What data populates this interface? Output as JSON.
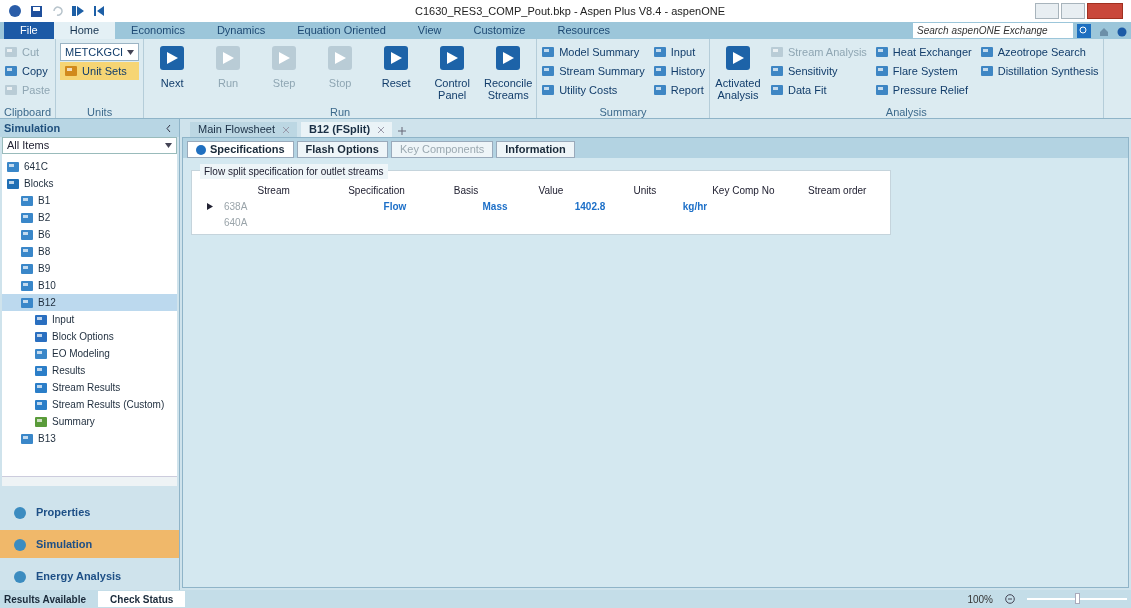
{
  "window": {
    "title": "C1630_RES3_COMP_Pout.bkp - Aspen Plus V8.4 - aspenONE"
  },
  "ribbon": {
    "tabs": [
      {
        "label": "File",
        "kind": "file",
        "selected": false
      },
      {
        "label": "Home",
        "kind": "tab",
        "selected": true
      },
      {
        "label": "Economics",
        "kind": "tab",
        "selected": false
      },
      {
        "label": "Dynamics",
        "kind": "tab",
        "selected": false
      },
      {
        "label": "Equation Oriented",
        "kind": "tab",
        "selected": false
      },
      {
        "label": "View",
        "kind": "tab",
        "selected": false
      },
      {
        "label": "Customize",
        "kind": "tab",
        "selected": false
      },
      {
        "label": "Resources",
        "kind": "tab",
        "selected": false
      }
    ],
    "search": {
      "placeholder": "Search aspenONE Exchange"
    },
    "groups": [
      {
        "label": "Clipboard",
        "columns": [
          [
            {
              "label": "Cut",
              "kind": "small",
              "disabled": true
            },
            {
              "label": "Copy",
              "kind": "small",
              "disabled": false
            },
            {
              "label": "Paste",
              "kind": "small",
              "disabled": true
            }
          ]
        ]
      },
      {
        "label": "Units",
        "columns": [
          [
            {
              "label": "METCKGCI",
              "kind": "dropdown",
              "disabled": false
            },
            {
              "label": "Unit Sets",
              "kind": "highlight",
              "disabled": false
            }
          ]
        ]
      },
      {
        "label": "Run",
        "columns": [
          [
            {
              "label": "Next",
              "kind": "large",
              "disabled": false
            }
          ],
          [
            {
              "label": "Run",
              "kind": "large",
              "disabled": true
            }
          ],
          [
            {
              "label": "Step",
              "kind": "large",
              "disabled": true
            }
          ],
          [
            {
              "label": "Stop",
              "kind": "large",
              "disabled": true
            }
          ],
          [
            {
              "label": "Reset",
              "kind": "large",
              "disabled": false
            }
          ],
          [
            {
              "label": "Control Panel",
              "kind": "large",
              "disabled": false
            }
          ],
          [
            {
              "label": "Reconcile Streams",
              "kind": "large",
              "disabled": false
            }
          ]
        ]
      },
      {
        "label": "Summary",
        "columns": [
          [
            {
              "label": "Model Summary",
              "kind": "small",
              "disabled": false
            },
            {
              "label": "Stream Summary",
              "kind": "small",
              "disabled": false
            },
            {
              "label": "Utility Costs",
              "kind": "small",
              "disabled": false
            }
          ],
          [
            {
              "label": "Input",
              "kind": "small",
              "disabled": false
            },
            {
              "label": "History",
              "kind": "small",
              "disabled": false
            },
            {
              "label": "Report",
              "kind": "small",
              "disabled": false
            }
          ]
        ]
      },
      {
        "label": "Analysis",
        "columns": [
          [
            {
              "label": "Activated Analysis",
              "kind": "large",
              "disabled": false
            }
          ],
          [
            {
              "label": "Stream Analysis",
              "kind": "small",
              "disabled": true
            },
            {
              "label": "Sensitivity",
              "kind": "small",
              "disabled": false
            },
            {
              "label": "Data Fit",
              "kind": "small",
              "disabled": false
            }
          ],
          [
            {
              "label": "Heat Exchanger",
              "kind": "small",
              "disabled": false
            },
            {
              "label": "Flare System",
              "kind": "small",
              "disabled": false
            },
            {
              "label": "Pressure Relief",
              "kind": "small",
              "disabled": false
            }
          ],
          [
            {
              "label": "Azeotrope Search",
              "kind": "small",
              "disabled": false
            },
            {
              "label": "Distillation Synthesis",
              "kind": "small",
              "disabled": false
            }
          ]
        ]
      }
    ]
  },
  "navigator": {
    "title": "Simulation",
    "filter": "All Items",
    "tree": [
      {
        "label": "641C",
        "kind": "folder",
        "selected": false
      },
      {
        "label": "Blocks",
        "kind": "root",
        "selected": false,
        "children": [
          {
            "label": "B1",
            "kind": "folder",
            "selected": false
          },
          {
            "label": "B2",
            "kind": "folder",
            "selected": false
          },
          {
            "label": "B6",
            "kind": "folder",
            "selected": false
          },
          {
            "label": "B8",
            "kind": "folder",
            "selected": false
          },
          {
            "label": "B9",
            "kind": "folder",
            "selected": false
          },
          {
            "label": "B10",
            "kind": "folder",
            "selected": false
          },
          {
            "label": "B12",
            "kind": "folder",
            "selected": true,
            "children": [
              {
                "label": "Input",
                "kind": "form",
                "selected": false
              },
              {
                "label": "Block Options",
                "kind": "form",
                "selected": false
              },
              {
                "label": "EO Modeling",
                "kind": "folder",
                "selected": false
              },
              {
                "label": "Results",
                "kind": "result",
                "selected": false
              },
              {
                "label": "Stream Results",
                "kind": "result",
                "selected": false
              },
              {
                "label": "Stream Results (Custom)",
                "kind": "result",
                "selected": false
              },
              {
                "label": "Summary",
                "kind": "summary",
                "selected": false
              }
            ]
          },
          {
            "label": "B13",
            "kind": "folder",
            "selected": false
          }
        ]
      }
    ],
    "panes": [
      {
        "label": "Properties",
        "selected": false
      },
      {
        "label": "Simulation",
        "selected": true
      },
      {
        "label": "Energy Analysis",
        "selected": false
      }
    ]
  },
  "documents": [
    {
      "label": "Main Flowsheet",
      "selected": false
    },
    {
      "label": "B12 (FSplit)",
      "selected": true
    }
  ],
  "form": {
    "tabs": [
      {
        "label": "Specifications",
        "selected": true,
        "disabled": false
      },
      {
        "label": "Flash Options",
        "selected": false,
        "disabled": false
      },
      {
        "label": "Key Components",
        "selected": false,
        "disabled": true
      },
      {
        "label": "Information",
        "selected": false,
        "disabled": false
      }
    ],
    "section": "Flow split specification for outlet streams",
    "columns": [
      "Stream",
      "Specification",
      "Basis",
      "Value",
      "Units",
      "Key Comp No",
      "Stream order"
    ],
    "rows": [
      {
        "current": true,
        "cells": [
          "638A",
          "Flow",
          "Mass",
          "1402.8",
          "kg/hr"
        ]
      },
      {
        "current": false,
        "cells": [
          "640A"
        ]
      }
    ]
  },
  "status_bar": {
    "message": "Results Available",
    "button": "Check Status",
    "zoom": "100%",
    "zoom_slider": {
      "level": 0.5
    }
  }
}
